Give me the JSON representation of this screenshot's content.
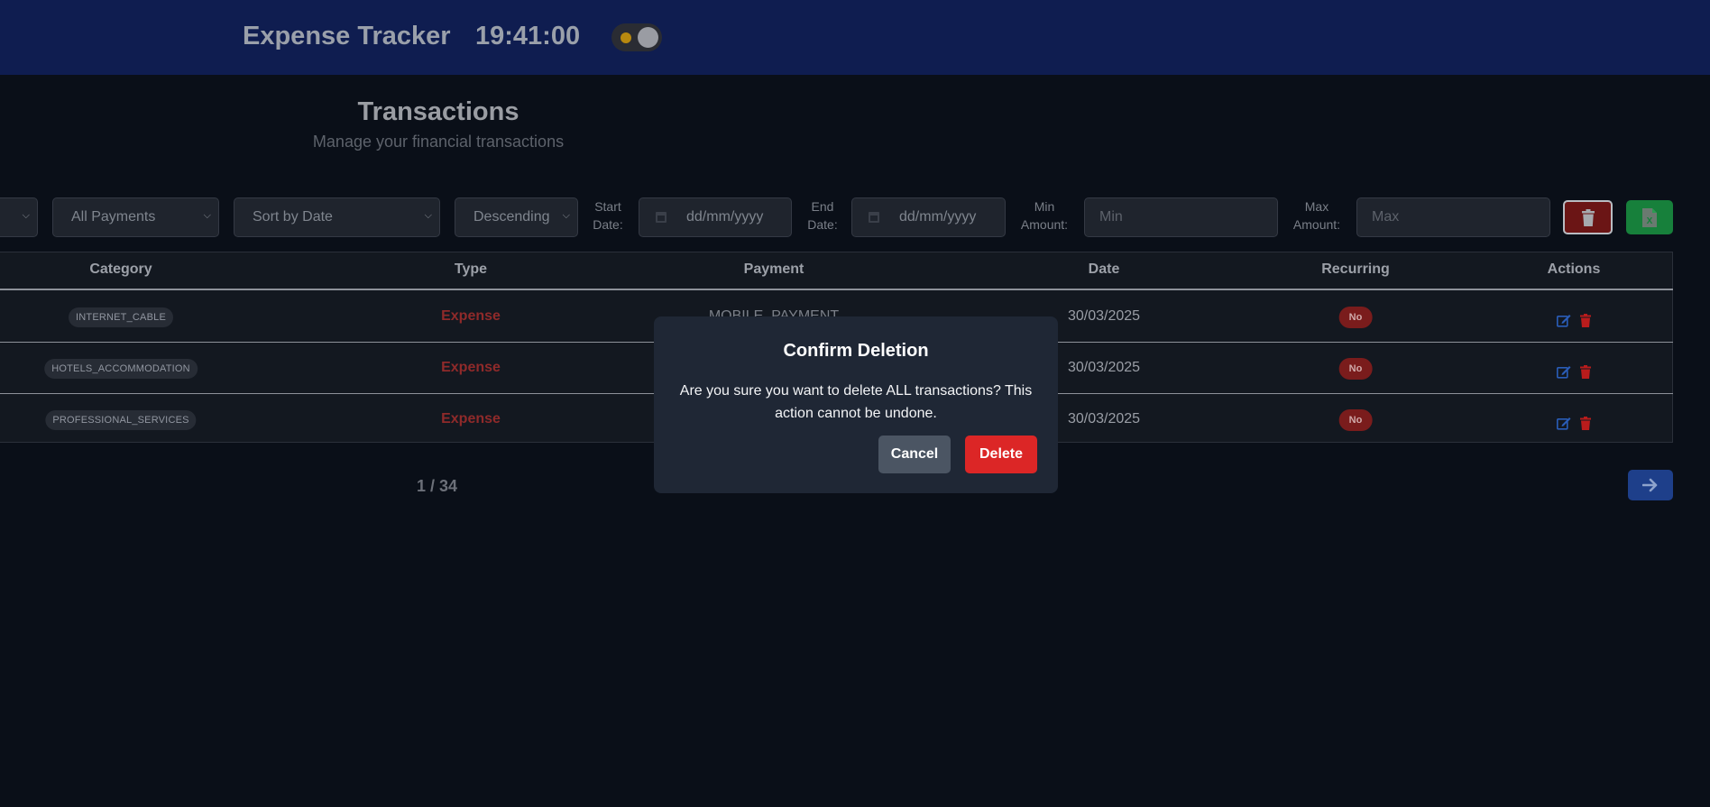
{
  "header": {
    "app_title": "Expense Tracker",
    "clock": "19:41:00"
  },
  "page": {
    "title": "Transactions",
    "subtitle": "Manage your financial transactions"
  },
  "filters": {
    "payments_select": "All Payments",
    "sort_select": "Sort by Date",
    "order_select": "Descending",
    "start_date_label_1": "Start",
    "start_date_label_2": "Date:",
    "start_date_placeholder": "dd/mm/yyyy",
    "end_date_label_1": "End",
    "end_date_label_2": "Date:",
    "end_date_placeholder": "dd/mm/yyyy",
    "min_label_1": "Min",
    "min_label_2": "Amount:",
    "min_placeholder": "Min",
    "max_label_1": "Max",
    "max_label_2": "Amount:",
    "max_placeholder": "Max"
  },
  "table": {
    "headers": [
      "Category",
      "Type",
      "Payment",
      "Date",
      "Recurring",
      "Actions"
    ],
    "rows": [
      {
        "category": "INTERNET_CABLE",
        "type": "Expense",
        "payment": "MOBILE_PAYMENT",
        "date": "30/03/2025",
        "recurring": "No"
      },
      {
        "category": "HOTELS_ACCOMMODATION",
        "type": "Expense",
        "payment": "",
        "date": "30/03/2025",
        "recurring": "No"
      },
      {
        "category": "PROFESSIONAL_SERVICES",
        "type": "Expense",
        "payment": "",
        "date": "30/03/2025",
        "recurring": "No"
      }
    ]
  },
  "pagination": {
    "page_info": "1 / 34"
  },
  "modal": {
    "title": "Confirm Deletion",
    "message": "Are you sure you want to delete ALL transactions? This action cannot be undone.",
    "cancel_label": "Cancel",
    "delete_label": "Delete"
  },
  "icons": {
    "theme_toggle": "sun-toggle-icon",
    "delete_all": "trash-icon",
    "export": "excel-file-icon",
    "edit": "edit-icon",
    "delete_row": "trash-icon",
    "next": "arrow-right-icon",
    "calendar": "calendar-icon"
  },
  "colors": {
    "header_bg": "#0f1d50",
    "page_bg": "#0a0f18",
    "expense": "#8f2a2a",
    "danger": "#dc2626",
    "success": "#17803b",
    "primary": "#1e3f8a"
  }
}
